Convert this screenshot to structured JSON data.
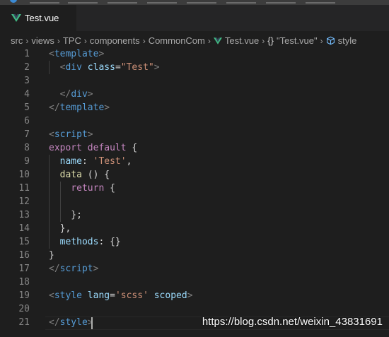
{
  "tab": {
    "label": "Test.vue"
  },
  "breadcrumb": {
    "segments": [
      "src",
      "views",
      "TPC",
      "components",
      "CommonCom",
      "Test.vue",
      "\"Test.vue\"",
      "style"
    ]
  },
  "editor": {
    "lines": [
      {
        "n": "1",
        "tokens": [
          [
            "t",
            "<"
          ],
          [
            "tag",
            "template"
          ],
          [
            "t",
            ">"
          ]
        ]
      },
      {
        "n": "2",
        "tokens": [
          [
            "p",
            "  "
          ],
          [
            "t",
            "<"
          ],
          [
            "tag",
            "div"
          ],
          [
            "p",
            " "
          ],
          [
            "attr",
            "class"
          ],
          [
            "p",
            "="
          ],
          [
            "str",
            "\"Test\""
          ],
          [
            "t",
            ">"
          ]
        ]
      },
      {
        "n": "3",
        "tokens": []
      },
      {
        "n": "4",
        "tokens": [
          [
            "p",
            "  "
          ],
          [
            "t",
            "</"
          ],
          [
            "tag",
            "div"
          ],
          [
            "t",
            ">"
          ]
        ]
      },
      {
        "n": "5",
        "tokens": [
          [
            "t",
            "</"
          ],
          [
            "tag",
            "template"
          ],
          [
            "t",
            ">"
          ]
        ]
      },
      {
        "n": "6",
        "tokens": []
      },
      {
        "n": "7",
        "tokens": [
          [
            "t",
            "<"
          ],
          [
            "tag",
            "script"
          ],
          [
            "t",
            ">"
          ]
        ]
      },
      {
        "n": "8",
        "tokens": [
          [
            "kw",
            "export"
          ],
          [
            "p",
            " "
          ],
          [
            "kw",
            "default"
          ],
          [
            "p",
            " {"
          ]
        ]
      },
      {
        "n": "9",
        "tokens": [
          [
            "p",
            "  "
          ],
          [
            "attr",
            "name"
          ],
          [
            "p",
            ": "
          ],
          [
            "str",
            "'Test'"
          ],
          [
            "p",
            ","
          ]
        ]
      },
      {
        "n": "10",
        "tokens": [
          [
            "p",
            "  "
          ],
          [
            "fn",
            "data"
          ],
          [
            "p",
            " () {"
          ]
        ]
      },
      {
        "n": "11",
        "tokens": [
          [
            "p",
            "    "
          ],
          [
            "kw",
            "return"
          ],
          [
            "p",
            " {"
          ]
        ]
      },
      {
        "n": "12",
        "tokens": []
      },
      {
        "n": "13",
        "tokens": [
          [
            "p",
            "    };"
          ]
        ]
      },
      {
        "n": "14",
        "tokens": [
          [
            "p",
            "  },"
          ]
        ]
      },
      {
        "n": "15",
        "tokens": [
          [
            "p",
            "  "
          ],
          [
            "attr",
            "methods"
          ],
          [
            "p",
            ": {}"
          ]
        ]
      },
      {
        "n": "16",
        "tokens": [
          [
            "p",
            "}"
          ]
        ]
      },
      {
        "n": "17",
        "tokens": [
          [
            "t",
            "</"
          ],
          [
            "tag",
            "script"
          ],
          [
            "t",
            ">"
          ]
        ]
      },
      {
        "n": "18",
        "tokens": []
      },
      {
        "n": "19",
        "tokens": [
          [
            "t",
            "<"
          ],
          [
            "tag",
            "style"
          ],
          [
            "p",
            " "
          ],
          [
            "attr",
            "lang"
          ],
          [
            "p",
            "="
          ],
          [
            "str",
            "'scss'"
          ],
          [
            "p",
            " "
          ],
          [
            "attr",
            "scoped"
          ],
          [
            "t",
            ">"
          ]
        ]
      },
      {
        "n": "20",
        "tokens": []
      },
      {
        "n": "21",
        "tokens": [
          [
            "t",
            "</"
          ],
          [
            "tag",
            "style"
          ],
          [
            "t",
            ">"
          ]
        ]
      }
    ]
  },
  "watermark": {
    "text": "https://blog.csdn.net/weixin_43831691"
  }
}
